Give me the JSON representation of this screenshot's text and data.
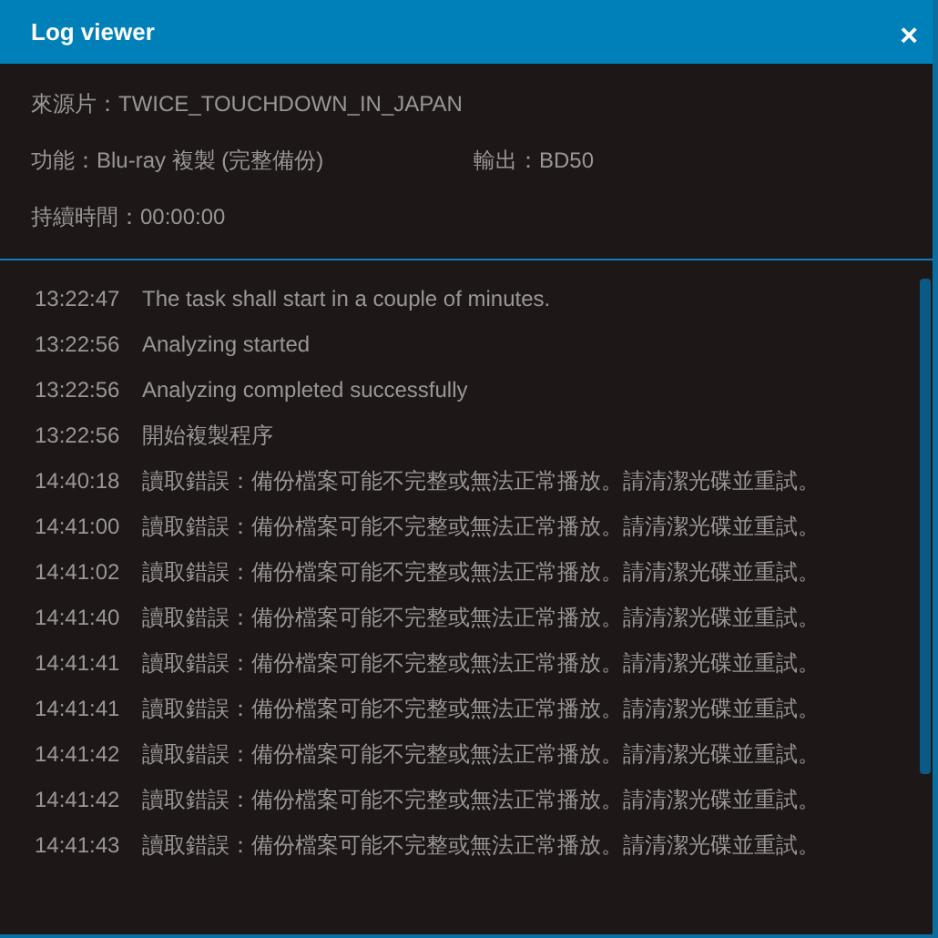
{
  "window": {
    "title": "Log viewer",
    "close": "×"
  },
  "info": {
    "source": "來源片：TWICE_TOUCHDOWN_IN_JAPAN",
    "function": "功能：Blu-ray 複製 (完整備份)",
    "output": "輸出：BD50",
    "duration": "持續時間：00:00:00"
  },
  "log": [
    {
      "time": "13:22:47",
      "message": "The task shall start in a couple of minutes."
    },
    {
      "time": "13:22:56",
      "message": "Analyzing started"
    },
    {
      "time": "13:22:56",
      "message": "Analyzing completed successfully"
    },
    {
      "time": "13:22:56",
      "message": "開始複製程序"
    },
    {
      "time": "14:40:18",
      "message": "讀取錯誤：備份檔案可能不完整或無法正常播放。請清潔光碟並重試。"
    },
    {
      "time": "14:41:00",
      "message": "讀取錯誤：備份檔案可能不完整或無法正常播放。請清潔光碟並重試。"
    },
    {
      "time": "14:41:02",
      "message": "讀取錯誤：備份檔案可能不完整或無法正常播放。請清潔光碟並重試。"
    },
    {
      "time": "14:41:40",
      "message": "讀取錯誤：備份檔案可能不完整或無法正常播放。請清潔光碟並重試。"
    },
    {
      "time": "14:41:41",
      "message": "讀取錯誤：備份檔案可能不完整或無法正常播放。請清潔光碟並重試。"
    },
    {
      "time": "14:41:41",
      "message": "讀取錯誤：備份檔案可能不完整或無法正常播放。請清潔光碟並重試。"
    },
    {
      "time": "14:41:42",
      "message": "讀取錯誤：備份檔案可能不完整或無法正常播放。請清潔光碟並重試。"
    },
    {
      "time": "14:41:42",
      "message": "讀取錯誤：備份檔案可能不完整或無法正常播放。請清潔光碟並重試。"
    },
    {
      "time": "14:41:43",
      "message": "讀取錯誤：備份檔案可能不完整或無法正常播放。請清潔光碟並重試。"
    }
  ]
}
